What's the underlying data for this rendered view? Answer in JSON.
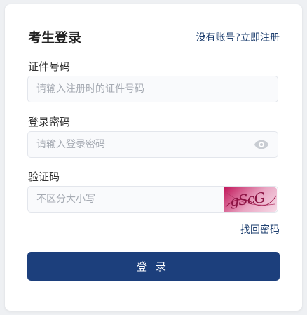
{
  "header": {
    "title": "考生登录",
    "register_link": "没有账号?立即注册"
  },
  "form": {
    "id_label": "证件号码",
    "id_placeholder": "请输入注册时的证件号码",
    "id_value": "",
    "password_label": "登录密码",
    "password_placeholder": "请输入登录密码",
    "password_value": "",
    "captcha_label": "验证码",
    "captcha_placeholder": "不区分大小写",
    "captcha_value": "",
    "captcha_image_text": "gScG"
  },
  "actions": {
    "forgot_password": "找回密码",
    "login_button": "登录"
  },
  "colors": {
    "primary": "#1c3f7c",
    "link": "#1e3f6f",
    "card_bg": "#ffffff",
    "page_bg": "#eef0f3"
  },
  "icons": {
    "password_toggle": "eye-icon"
  }
}
